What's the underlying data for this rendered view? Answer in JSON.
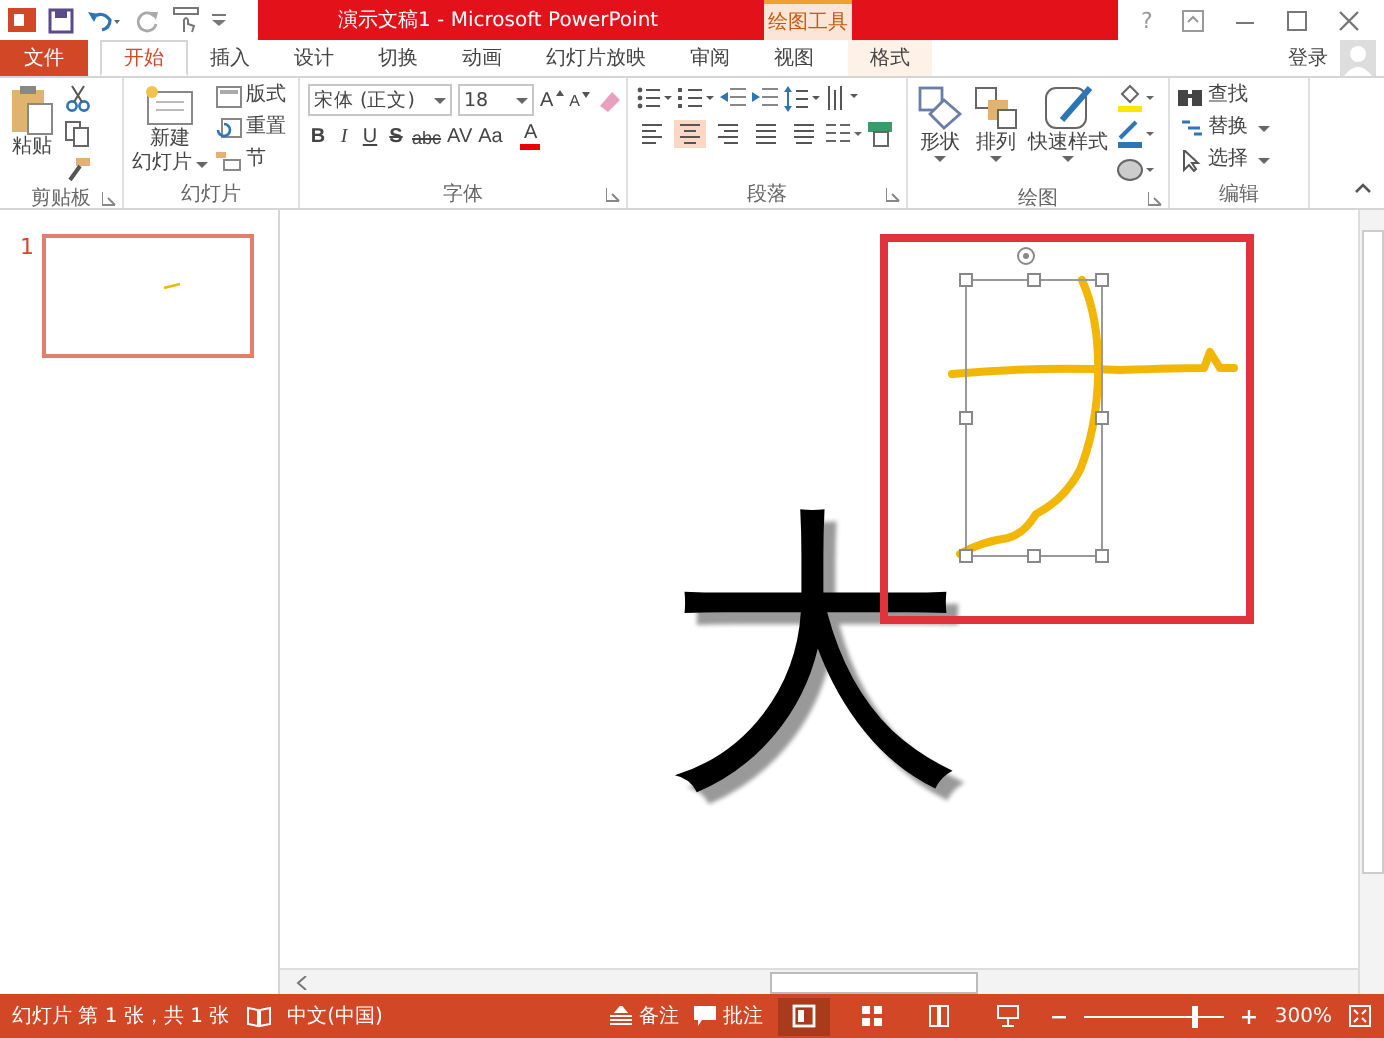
{
  "title_bar": {
    "title": "演示文稿1 - Microsoft PowerPoint",
    "context_tab": "绘图工具",
    "help": "?"
  },
  "tabs": [
    {
      "label": "文件",
      "kind": "file",
      "selected": false
    },
    {
      "label": "开始",
      "kind": "normal",
      "selected": true
    },
    {
      "label": "插入",
      "kind": "normal",
      "selected": false
    },
    {
      "label": "设计",
      "kind": "normal",
      "selected": false
    },
    {
      "label": "切换",
      "kind": "normal",
      "selected": false
    },
    {
      "label": "动画",
      "kind": "normal",
      "selected": false
    },
    {
      "label": "幻灯片放映",
      "kind": "normal",
      "selected": false
    },
    {
      "label": "审阅",
      "kind": "normal",
      "selected": false
    },
    {
      "label": "视图",
      "kind": "normal",
      "selected": false
    },
    {
      "label": "格式",
      "kind": "context",
      "selected": false
    }
  ],
  "sign_in": "登录",
  "ribbon": {
    "clipboard": {
      "name": "剪贴板",
      "paste": "粘贴"
    },
    "slides": {
      "name": "幻灯片",
      "new_slide": [
        "新建",
        "幻灯片"
      ],
      "layout": "版式",
      "reset": "重置",
      "section": "节"
    },
    "font": {
      "name": "字体",
      "font_name": "宋体 (正文)",
      "font_size": "18",
      "grow": "A",
      "shrink": "A",
      "format_buttons": [
        "B",
        "I",
        "U",
        "S",
        "abc",
        "AV",
        "Aa"
      ],
      "font_color": "A"
    },
    "paragraph": {
      "name": "段落",
      "alignment": [
        {
          "kind": "left",
          "selected": false
        },
        {
          "kind": "center",
          "selected": true
        },
        {
          "kind": "right",
          "selected": false
        },
        {
          "kind": "justify",
          "selected": false
        },
        {
          "kind": "distributed",
          "selected": false
        }
      ]
    },
    "drawing": {
      "name": "绘图",
      "shapes": "形状",
      "arrange": "排列",
      "quick_styles": "快速样式"
    },
    "editing": {
      "name": "编辑",
      "find": "查找",
      "replace": "替换",
      "select": "选择"
    }
  },
  "thumbnails": [
    {
      "number": "1",
      "selected": true
    }
  ],
  "slide": {
    "text": "大"
  },
  "status_bar": {
    "slide_info": "幻灯片 第 1 张，共 1 张",
    "language": "中文(中国)",
    "notes": "备注",
    "comments": "批注",
    "views": [
      {
        "kind": "normal",
        "selected": true
      },
      {
        "kind": "sorter",
        "selected": false
      },
      {
        "kind": "reading",
        "selected": false
      },
      {
        "kind": "show",
        "selected": false
      }
    ],
    "zoom": {
      "level": 0.78
    },
    "zoom_text": "300%"
  }
}
